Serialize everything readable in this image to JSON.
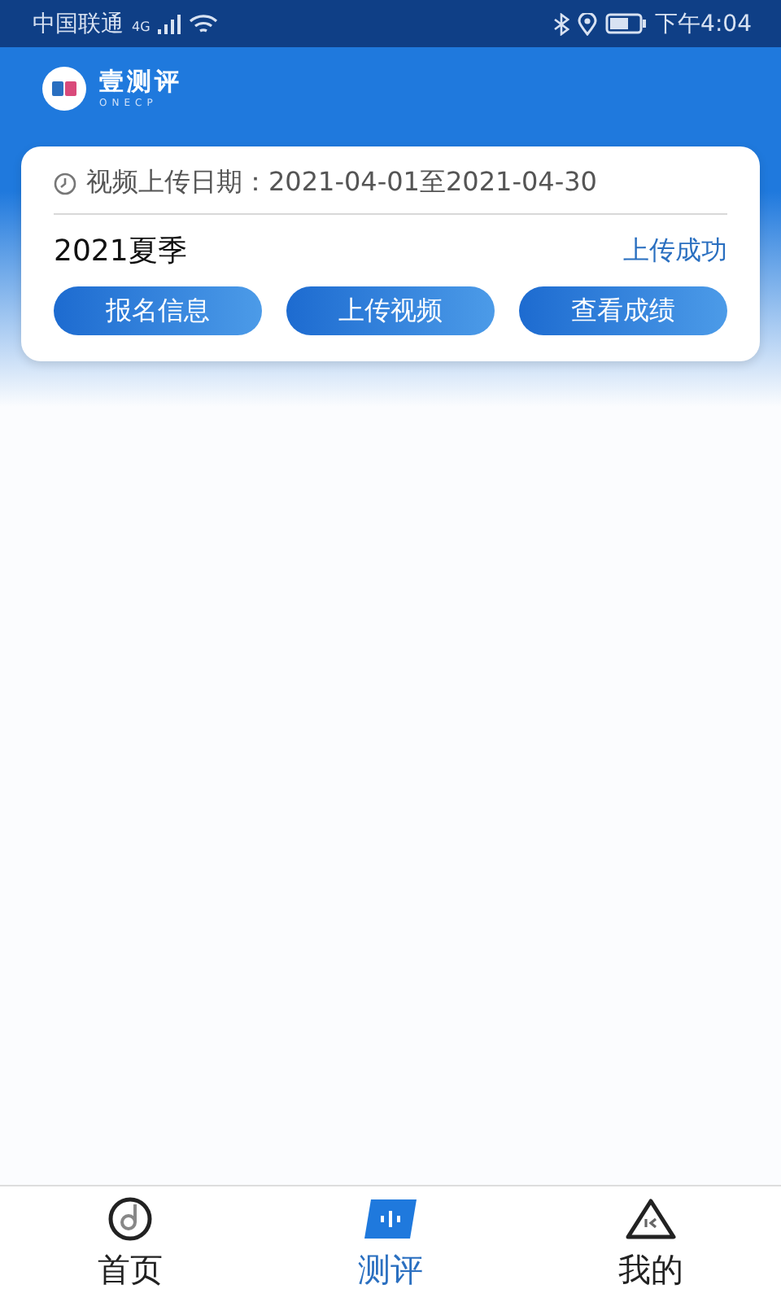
{
  "status_bar": {
    "carrier": "中国联通",
    "network": "4G",
    "time": "下午4:04"
  },
  "header": {
    "brand": "壹测评",
    "brand_sub": "ONECP"
  },
  "card": {
    "date_label": "视频上传日期：2021-04-01至2021-04-30",
    "season": "2021夏季",
    "status": "上传成功",
    "buttons": [
      "报名信息",
      "上传视频",
      "查看成绩"
    ]
  },
  "tabs": [
    {
      "label": "首页",
      "kind": "home",
      "selected": false
    },
    {
      "label": "测评",
      "kind": "eval",
      "selected": true
    },
    {
      "label": "我的",
      "kind": "mine",
      "selected": false
    }
  ]
}
